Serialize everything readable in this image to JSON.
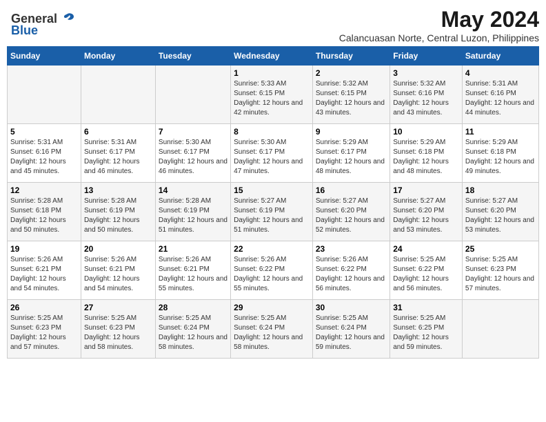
{
  "header": {
    "logo_general": "General",
    "logo_blue": "Blue",
    "month": "May 2024",
    "location": "Calancuasan Norte, Central Luzon, Philippines"
  },
  "days_of_week": [
    "Sunday",
    "Monday",
    "Tuesday",
    "Wednesday",
    "Thursday",
    "Friday",
    "Saturday"
  ],
  "weeks": [
    [
      {
        "day": "",
        "sunrise": "",
        "sunset": "",
        "daylight": ""
      },
      {
        "day": "",
        "sunrise": "",
        "sunset": "",
        "daylight": ""
      },
      {
        "day": "",
        "sunrise": "",
        "sunset": "",
        "daylight": ""
      },
      {
        "day": "1",
        "sunrise": "Sunrise: 5:33 AM",
        "sunset": "Sunset: 6:15 PM",
        "daylight": "Daylight: 12 hours and 42 minutes."
      },
      {
        "day": "2",
        "sunrise": "Sunrise: 5:32 AM",
        "sunset": "Sunset: 6:15 PM",
        "daylight": "Daylight: 12 hours and 43 minutes."
      },
      {
        "day": "3",
        "sunrise": "Sunrise: 5:32 AM",
        "sunset": "Sunset: 6:16 PM",
        "daylight": "Daylight: 12 hours and 43 minutes."
      },
      {
        "day": "4",
        "sunrise": "Sunrise: 5:31 AM",
        "sunset": "Sunset: 6:16 PM",
        "daylight": "Daylight: 12 hours and 44 minutes."
      }
    ],
    [
      {
        "day": "5",
        "sunrise": "Sunrise: 5:31 AM",
        "sunset": "Sunset: 6:16 PM",
        "daylight": "Daylight: 12 hours and 45 minutes."
      },
      {
        "day": "6",
        "sunrise": "Sunrise: 5:31 AM",
        "sunset": "Sunset: 6:17 PM",
        "daylight": "Daylight: 12 hours and 46 minutes."
      },
      {
        "day": "7",
        "sunrise": "Sunrise: 5:30 AM",
        "sunset": "Sunset: 6:17 PM",
        "daylight": "Daylight: 12 hours and 46 minutes."
      },
      {
        "day": "8",
        "sunrise": "Sunrise: 5:30 AM",
        "sunset": "Sunset: 6:17 PM",
        "daylight": "Daylight: 12 hours and 47 minutes."
      },
      {
        "day": "9",
        "sunrise": "Sunrise: 5:29 AM",
        "sunset": "Sunset: 6:17 PM",
        "daylight": "Daylight: 12 hours and 48 minutes."
      },
      {
        "day": "10",
        "sunrise": "Sunrise: 5:29 AM",
        "sunset": "Sunset: 6:18 PM",
        "daylight": "Daylight: 12 hours and 48 minutes."
      },
      {
        "day": "11",
        "sunrise": "Sunrise: 5:29 AM",
        "sunset": "Sunset: 6:18 PM",
        "daylight": "Daylight: 12 hours and 49 minutes."
      }
    ],
    [
      {
        "day": "12",
        "sunrise": "Sunrise: 5:28 AM",
        "sunset": "Sunset: 6:18 PM",
        "daylight": "Daylight: 12 hours and 50 minutes."
      },
      {
        "day": "13",
        "sunrise": "Sunrise: 5:28 AM",
        "sunset": "Sunset: 6:19 PM",
        "daylight": "Daylight: 12 hours and 50 minutes."
      },
      {
        "day": "14",
        "sunrise": "Sunrise: 5:28 AM",
        "sunset": "Sunset: 6:19 PM",
        "daylight": "Daylight: 12 hours and 51 minutes."
      },
      {
        "day": "15",
        "sunrise": "Sunrise: 5:27 AM",
        "sunset": "Sunset: 6:19 PM",
        "daylight": "Daylight: 12 hours and 51 minutes."
      },
      {
        "day": "16",
        "sunrise": "Sunrise: 5:27 AM",
        "sunset": "Sunset: 6:20 PM",
        "daylight": "Daylight: 12 hours and 52 minutes."
      },
      {
        "day": "17",
        "sunrise": "Sunrise: 5:27 AM",
        "sunset": "Sunset: 6:20 PM",
        "daylight": "Daylight: 12 hours and 53 minutes."
      },
      {
        "day": "18",
        "sunrise": "Sunrise: 5:27 AM",
        "sunset": "Sunset: 6:20 PM",
        "daylight": "Daylight: 12 hours and 53 minutes."
      }
    ],
    [
      {
        "day": "19",
        "sunrise": "Sunrise: 5:26 AM",
        "sunset": "Sunset: 6:21 PM",
        "daylight": "Daylight: 12 hours and 54 minutes."
      },
      {
        "day": "20",
        "sunrise": "Sunrise: 5:26 AM",
        "sunset": "Sunset: 6:21 PM",
        "daylight": "Daylight: 12 hours and 54 minutes."
      },
      {
        "day": "21",
        "sunrise": "Sunrise: 5:26 AM",
        "sunset": "Sunset: 6:21 PM",
        "daylight": "Daylight: 12 hours and 55 minutes."
      },
      {
        "day": "22",
        "sunrise": "Sunrise: 5:26 AM",
        "sunset": "Sunset: 6:22 PM",
        "daylight": "Daylight: 12 hours and 55 minutes."
      },
      {
        "day": "23",
        "sunrise": "Sunrise: 5:26 AM",
        "sunset": "Sunset: 6:22 PM",
        "daylight": "Daylight: 12 hours and 56 minutes."
      },
      {
        "day": "24",
        "sunrise": "Sunrise: 5:25 AM",
        "sunset": "Sunset: 6:22 PM",
        "daylight": "Daylight: 12 hours and 56 minutes."
      },
      {
        "day": "25",
        "sunrise": "Sunrise: 5:25 AM",
        "sunset": "Sunset: 6:23 PM",
        "daylight": "Daylight: 12 hours and 57 minutes."
      }
    ],
    [
      {
        "day": "26",
        "sunrise": "Sunrise: 5:25 AM",
        "sunset": "Sunset: 6:23 PM",
        "daylight": "Daylight: 12 hours and 57 minutes."
      },
      {
        "day": "27",
        "sunrise": "Sunrise: 5:25 AM",
        "sunset": "Sunset: 6:23 PM",
        "daylight": "Daylight: 12 hours and 58 minutes."
      },
      {
        "day": "28",
        "sunrise": "Sunrise: 5:25 AM",
        "sunset": "Sunset: 6:24 PM",
        "daylight": "Daylight: 12 hours and 58 minutes."
      },
      {
        "day": "29",
        "sunrise": "Sunrise: 5:25 AM",
        "sunset": "Sunset: 6:24 PM",
        "daylight": "Daylight: 12 hours and 58 minutes."
      },
      {
        "day": "30",
        "sunrise": "Sunrise: 5:25 AM",
        "sunset": "Sunset: 6:24 PM",
        "daylight": "Daylight: 12 hours and 59 minutes."
      },
      {
        "day": "31",
        "sunrise": "Sunrise: 5:25 AM",
        "sunset": "Sunset: 6:25 PM",
        "daylight": "Daylight: 12 hours and 59 minutes."
      },
      {
        "day": "",
        "sunrise": "",
        "sunset": "",
        "daylight": ""
      }
    ]
  ]
}
